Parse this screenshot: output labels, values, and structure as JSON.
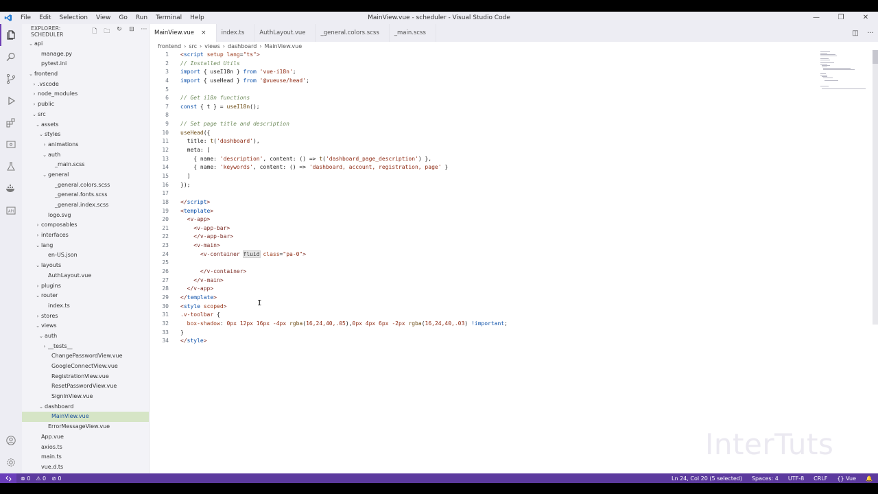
{
  "window": {
    "title": "MainView.vue - scheduler - Visual Studio Code",
    "menu": [
      "File",
      "Edit",
      "Selection",
      "View",
      "Go",
      "Run",
      "Terminal",
      "Help"
    ],
    "controls": [
      "—",
      "❐",
      "✕"
    ]
  },
  "colors": {
    "accent": "#6d3db3",
    "statusbar": "#5c3a9e",
    "selected_row": "#d6e5c6"
  },
  "sidebar": {
    "title": "EXPLORER: SCHEDULER",
    "actions": [
      "new-file-icon",
      "new-folder-icon",
      "refresh-icon",
      "collapse-icon",
      "more-icon"
    ],
    "tree": [
      {
        "label": "api",
        "indent": 0,
        "chev": "open"
      },
      {
        "label": "manage.py",
        "indent": 2,
        "chev": ""
      },
      {
        "label": "pytest.ini",
        "indent": 2,
        "chev": ""
      },
      {
        "label": "frontend",
        "indent": 0,
        "chev": "open"
      },
      {
        "label": ".vscode",
        "indent": 1,
        "chev": "closed"
      },
      {
        "label": "node_modules",
        "indent": 1,
        "chev": "closed"
      },
      {
        "label": "public",
        "indent": 1,
        "chev": "closed"
      },
      {
        "label": "src",
        "indent": 1,
        "chev": "open"
      },
      {
        "label": "assets",
        "indent": 2,
        "chev": "open"
      },
      {
        "label": "styles",
        "indent": 3,
        "chev": "open"
      },
      {
        "label": "animations",
        "indent": 4,
        "chev": "closed"
      },
      {
        "label": "auth",
        "indent": 4,
        "chev": "open"
      },
      {
        "label": "_main.scss",
        "indent": 6,
        "chev": ""
      },
      {
        "label": "general",
        "indent": 4,
        "chev": "open"
      },
      {
        "label": "_general.colors.scss",
        "indent": 6,
        "chev": ""
      },
      {
        "label": "_general.fonts.scss",
        "indent": 6,
        "chev": ""
      },
      {
        "label": "_general.index.scss",
        "indent": 6,
        "chev": ""
      },
      {
        "label": "logo.svg",
        "indent": 4,
        "chev": ""
      },
      {
        "label": "composables",
        "indent": 2,
        "chev": "closed"
      },
      {
        "label": "interfaces",
        "indent": 2,
        "chev": "closed"
      },
      {
        "label": "lang",
        "indent": 2,
        "chev": "open"
      },
      {
        "label": "en-US.json",
        "indent": 4,
        "chev": ""
      },
      {
        "label": "layouts",
        "indent": 2,
        "chev": "open"
      },
      {
        "label": "AuthLayout.vue",
        "indent": 4,
        "chev": ""
      },
      {
        "label": "plugins",
        "indent": 2,
        "chev": "closed"
      },
      {
        "label": "router",
        "indent": 2,
        "chev": "open"
      },
      {
        "label": "index.ts",
        "indent": 4,
        "chev": ""
      },
      {
        "label": "stores",
        "indent": 2,
        "chev": "closed"
      },
      {
        "label": "views",
        "indent": 2,
        "chev": "open"
      },
      {
        "label": "auth",
        "indent": 3,
        "chev": "open"
      },
      {
        "label": "__tests__",
        "indent": 4,
        "chev": "closed"
      },
      {
        "label": "ChangePasswordView.vue",
        "indent": 5,
        "chev": ""
      },
      {
        "label": "GoogleConnectView.vue",
        "indent": 5,
        "chev": ""
      },
      {
        "label": "RegistrationView.vue",
        "indent": 5,
        "chev": ""
      },
      {
        "label": "ResetPasswordView.vue",
        "indent": 5,
        "chev": ""
      },
      {
        "label": "SignInView.vue",
        "indent": 5,
        "chev": ""
      },
      {
        "label": "dashboard",
        "indent": 3,
        "chev": "open"
      },
      {
        "label": "MainView.vue",
        "indent": 5,
        "chev": "",
        "selected": true
      },
      {
        "label": "ErrorMessageView.vue",
        "indent": 4,
        "chev": ""
      },
      {
        "label": "App.vue",
        "indent": 2,
        "chev": ""
      },
      {
        "label": "axios.ts",
        "indent": 2,
        "chev": ""
      },
      {
        "label": "main.ts",
        "indent": 2,
        "chev": ""
      },
      {
        "label": "vue.d.ts",
        "indent": 2,
        "chev": ""
      }
    ]
  },
  "tabs": [
    {
      "label": "MainView.vue",
      "active": true,
      "close": "×"
    },
    {
      "label": "index.ts",
      "active": false
    },
    {
      "label": "AuthLayout.vue",
      "active": false
    },
    {
      "label": "_general.colors.scss",
      "active": false
    },
    {
      "label": "_main.scss",
      "active": false
    }
  ],
  "breadcrumb": [
    "frontend",
    "src",
    "views",
    "dashboard",
    "MainView.vue"
  ],
  "code": [
    [
      [
        "k-tag",
        "<"
      ],
      [
        "k-kw",
        "script"
      ],
      [
        "k-def",
        " "
      ],
      [
        "k-attr",
        "setup"
      ],
      [
        "k-def",
        " "
      ],
      [
        "k-attr",
        "lang"
      ],
      [
        "k-def",
        "="
      ],
      [
        "k-str",
        "\"ts\""
      ],
      [
        "k-tag",
        ">"
      ]
    ],
    [
      [
        "k-com",
        "// Installed Utils"
      ]
    ],
    [
      [
        "k-imp",
        "import"
      ],
      [
        "k-def",
        " { useI18n } "
      ],
      [
        "k-imp",
        "from"
      ],
      [
        "k-def",
        " "
      ],
      [
        "k-str",
        "'vue-i18n'"
      ],
      [
        "k-def",
        ";"
      ]
    ],
    [
      [
        "k-imp",
        "import"
      ],
      [
        "k-def",
        " { useHead } "
      ],
      [
        "k-imp",
        "from"
      ],
      [
        "k-def",
        " "
      ],
      [
        "k-str",
        "'@vueuse/head'"
      ],
      [
        "k-def",
        ";"
      ]
    ],
    [],
    [
      [
        "k-com",
        "// Get i18n functions"
      ]
    ],
    [
      [
        "k-kw",
        "const"
      ],
      [
        "k-def",
        " { t } = "
      ],
      [
        "k-fn",
        "useI18n"
      ],
      [
        "k-def",
        "();"
      ]
    ],
    [],
    [
      [
        "k-com",
        "// Set page title and description"
      ]
    ],
    [
      [
        "k-fn",
        "useHead"
      ],
      [
        "k-def",
        "({"
      ]
    ],
    [
      [
        "k-def",
        "  title: "
      ],
      [
        "k-fn",
        "t"
      ],
      [
        "k-def",
        "("
      ],
      [
        "k-str",
        "'dashboard'"
      ],
      [
        "k-def",
        "),"
      ]
    ],
    [
      [
        "k-def",
        "  meta: ["
      ]
    ],
    [
      [
        "k-def",
        "    { name: "
      ],
      [
        "k-str",
        "'description'"
      ],
      [
        "k-def",
        ", "
      ],
      [
        "k-def",
        "content"
      ],
      [
        "k-def",
        ": () => "
      ],
      [
        "k-fn",
        "t"
      ],
      [
        "k-def",
        "("
      ],
      [
        "k-str",
        "'dashboard_page_description'"
      ],
      [
        "k-def",
        ") },"
      ]
    ],
    [
      [
        "k-def",
        "    { name: "
      ],
      [
        "k-str",
        "'keywords'"
      ],
      [
        "k-def",
        ", "
      ],
      [
        "k-def",
        "content"
      ],
      [
        "k-def",
        ": () => "
      ],
      [
        "k-str",
        "'dashboard, account, registration, page'"
      ],
      [
        "k-def",
        " }"
      ]
    ],
    [
      [
        "k-def",
        "  ]"
      ]
    ],
    [
      [
        "k-def",
        "});"
      ]
    ],
    [],
    [
      [
        "k-tag",
        "</"
      ],
      [
        "k-kw",
        "script"
      ],
      [
        "k-tag",
        ">"
      ]
    ],
    [
      [
        "k-tag",
        "<"
      ],
      [
        "k-kw",
        "template"
      ],
      [
        "k-tag",
        ">"
      ]
    ],
    [
      [
        "k-tag",
        "  <"
      ],
      [
        "k-tag",
        "v-app"
      ],
      [
        "k-tag",
        ">"
      ]
    ],
    [
      [
        "k-tag",
        "    <"
      ],
      [
        "k-tag",
        "v-app-bar"
      ],
      [
        "k-tag",
        ">"
      ]
    ],
    [
      [
        "k-tag",
        "    </"
      ],
      [
        "k-tag",
        "v-app-bar"
      ],
      [
        "k-tag",
        ">"
      ]
    ],
    [
      [
        "k-tag",
        "    <"
      ],
      [
        "k-tag",
        "v-main"
      ],
      [
        "k-tag",
        ">"
      ]
    ],
    [
      [
        "k-tag",
        "      <"
      ],
      [
        "k-tag",
        "v-container"
      ],
      [
        "k-def",
        " "
      ],
      [
        "hl",
        "fluid"
      ],
      [
        "k-def",
        " "
      ],
      [
        "k-attr",
        "class"
      ],
      [
        "k-def",
        "="
      ],
      [
        "k-str",
        "\"pa-0\""
      ],
      [
        "k-tag",
        ">"
      ]
    ],
    [],
    [
      [
        "k-tag",
        "      </"
      ],
      [
        "k-tag",
        "v-container"
      ],
      [
        "k-tag",
        ">"
      ]
    ],
    [
      [
        "k-tag",
        "    </"
      ],
      [
        "k-tag",
        "v-main"
      ],
      [
        "k-tag",
        ">"
      ]
    ],
    [
      [
        "k-tag",
        "  </"
      ],
      [
        "k-tag",
        "v-app"
      ],
      [
        "k-tag",
        ">"
      ]
    ],
    [
      [
        "k-tag",
        "</"
      ],
      [
        "k-kw",
        "template"
      ],
      [
        "k-tag",
        ">"
      ]
    ],
    [
      [
        "k-tag",
        "<"
      ],
      [
        "k-kw",
        "style"
      ],
      [
        "k-def",
        " "
      ],
      [
        "k-attr",
        "scoped"
      ],
      [
        "k-tag",
        ">"
      ]
    ],
    [
      [
        "k-str",
        ".v-toolbar"
      ],
      [
        "k-def",
        " {"
      ]
    ],
    [
      [
        "k-def",
        "  "
      ],
      [
        "k-attr",
        "box-shadow"
      ],
      [
        "k-def",
        ": "
      ],
      [
        "k-str",
        "0px 12px 16px -4px"
      ],
      [
        "k-def",
        " "
      ],
      [
        "k-fn",
        "rgba"
      ],
      [
        "k-def",
        "("
      ],
      [
        "k-str",
        "16,24,40,.05"
      ],
      [
        "k-def",
        "),"
      ],
      [
        "k-str",
        "0px 4px 6px -2px"
      ],
      [
        "k-def",
        " "
      ],
      [
        "k-fn",
        "rgba"
      ],
      [
        "k-def",
        "("
      ],
      [
        "k-str",
        "16,24,40,.03"
      ],
      [
        "k-def",
        ") "
      ],
      [
        "k-kw",
        "!important"
      ],
      [
        "k-def",
        ";"
      ]
    ],
    [
      [
        "k-def",
        "}"
      ]
    ],
    [
      [
        "k-tag",
        "</"
      ],
      [
        "k-kw",
        "style"
      ],
      [
        "k-tag",
        ">"
      ]
    ]
  ],
  "watermark": "InterTuts",
  "status": {
    "left": [
      "⊗ 0",
      "⚠ 0",
      "⊘ 0"
    ],
    "right": [
      "Ln 24, Col 20 (5 selected)",
      "Spaces: 4",
      "UTF-8",
      "CRLF",
      "{} Vue",
      "🔔"
    ]
  }
}
